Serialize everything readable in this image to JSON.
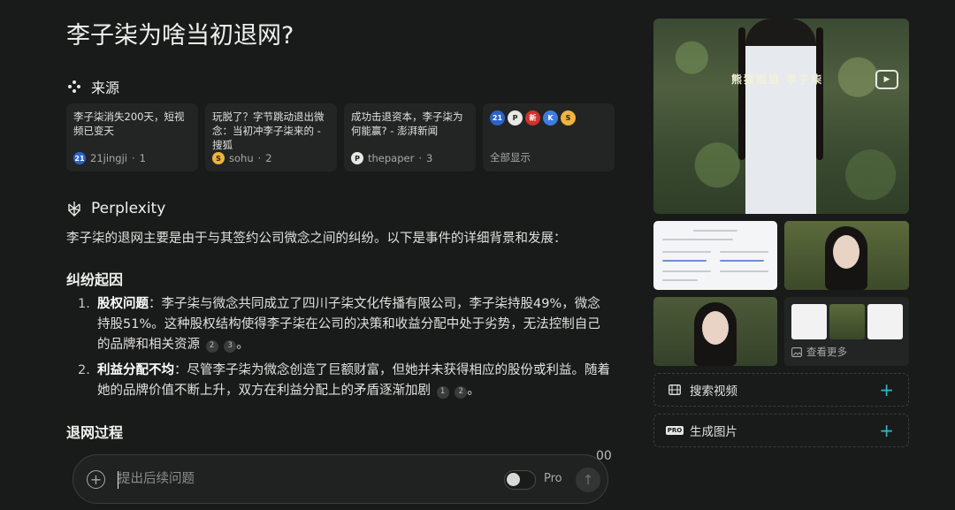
{
  "page": {
    "title": "李子柒为啥当初退网?"
  },
  "sources": {
    "heading": "来源",
    "cards": [
      {
        "title": "李子柒消失200天，短视频已变天",
        "site": "21jingji",
        "index": "1",
        "fav_text": "21",
        "fav_color": "#2b63c9"
      },
      {
        "title": "玩脱了？字节跳动退出微念：当初冲李子柒来的 - 搜狐",
        "site": "sohu",
        "index": "2",
        "fav_text": "S",
        "fav_color": "#f0b43c"
      },
      {
        "title": "成功击退资本，李子柒为何能赢? - 澎湃新闻",
        "site": "thepaper",
        "index": "3",
        "fav_text": "P",
        "fav_color": "#e8e8e6"
      }
    ],
    "show_all": "全部显示",
    "more_favicons": [
      {
        "text": "21",
        "color": "#2b63c9"
      },
      {
        "text": "P",
        "color": "#e8e8e6"
      },
      {
        "text": "新",
        "color": "#d0312d"
      },
      {
        "text": "K",
        "color": "#3c7de0"
      },
      {
        "text": "S",
        "color": "#f0b43c"
      }
    ]
  },
  "answer": {
    "brand": "Perplexity",
    "intro": "李子柒的退网主要是由于与其签约公司微念之间的纠纷。以下是事件的详细背景和发展：",
    "section1": "纠纷起因",
    "points": [
      {
        "num": "1.",
        "title": "股权问题",
        "text": "：李子柒与微念共同成立了四川子柒文化传播有限公司，李子柒持股49%，微念持股51%。这种股权结构使得李子柒在公司的决策和收益分配中处于劣势，无法控制自己的品牌和相关资源",
        "cites": [
          "2",
          "3"
        ],
        "end": "。"
      },
      {
        "num": "2.",
        "title": "利益分配不均",
        "text": "：尽管李子柒为微念创造了巨额财富，但她并未获得相应的股份或利益。随着她的品牌价值不断上升，双方在利益分配上的矛盾逐渐加剧",
        "cites": [
          "1",
          "2"
        ],
        "end": "。"
      }
    ],
    "section2": "退网过程",
    "cutoff": "00"
  },
  "followup": {
    "placeholder": "提出后续问题",
    "pro_label": "Pro"
  },
  "sidebar": {
    "hero_caption": "熊猫姐姐 李子柒",
    "view_more": "查看更多",
    "search_video": "搜索视频",
    "generate_image": "生成图片",
    "pro_badge": "PRO"
  },
  "colors": {
    "background": "#191a1a",
    "card": "#232525",
    "accent": "#2fb8c6"
  }
}
